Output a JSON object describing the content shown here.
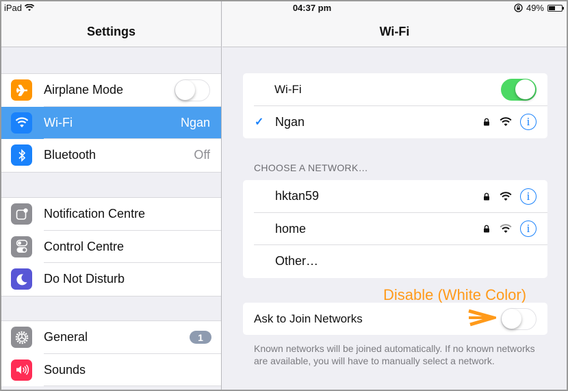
{
  "status_bar": {
    "device": "iPad",
    "time": "04:37 pm",
    "battery_percent_label": "49%",
    "battery_level": 0.49
  },
  "settings": {
    "title": "Settings",
    "groups": [
      {
        "items": [
          {
            "label": "Airplane Mode",
            "icon": "airplane-icon",
            "icon_color": "#ff9500",
            "toggle": false
          },
          {
            "label": "Wi-Fi",
            "icon": "wifi-icon",
            "icon_color": "#1a82fb",
            "value": "Ngan",
            "selected": true
          },
          {
            "label": "Bluetooth",
            "icon": "bluetooth-icon",
            "icon_color": "#1a82fb",
            "value": "Off"
          }
        ]
      },
      {
        "items": [
          {
            "label": "Notification Centre",
            "icon": "notification-centre-icon",
            "icon_color": "#8e8e93"
          },
          {
            "label": "Control Centre",
            "icon": "control-centre-icon",
            "icon_color": "#8e8e93"
          },
          {
            "label": "Do Not Disturb",
            "icon": "moon-icon",
            "icon_color": "#5856d6"
          }
        ]
      },
      {
        "items": [
          {
            "label": "General",
            "icon": "gear-icon",
            "icon_color": "#8e8e93",
            "badge": "1"
          },
          {
            "label": "Sounds",
            "icon": "speaker-icon",
            "icon_color": "#ff2d55"
          }
        ]
      }
    ]
  },
  "wifi": {
    "title": "Wi-Fi",
    "wifi_toggle_label": "Wi-Fi",
    "wifi_enabled": true,
    "connected_network": "Ngan",
    "choose_header": "CHOOSE A NETWORK…",
    "networks": [
      {
        "name": "hktan59",
        "secured": true,
        "signal": "full"
      },
      {
        "name": "home",
        "secured": true,
        "signal": "medium"
      }
    ],
    "other_label": "Other…",
    "ask_to_join_label": "Ask to Join Networks",
    "ask_to_join_enabled": false,
    "footer_note": "Known networks will be joined automatically. If no known networks are available, you will have to manually select a network."
  },
  "annotation": {
    "text": "Disable (White Color)",
    "color": "#ff9a1a"
  }
}
